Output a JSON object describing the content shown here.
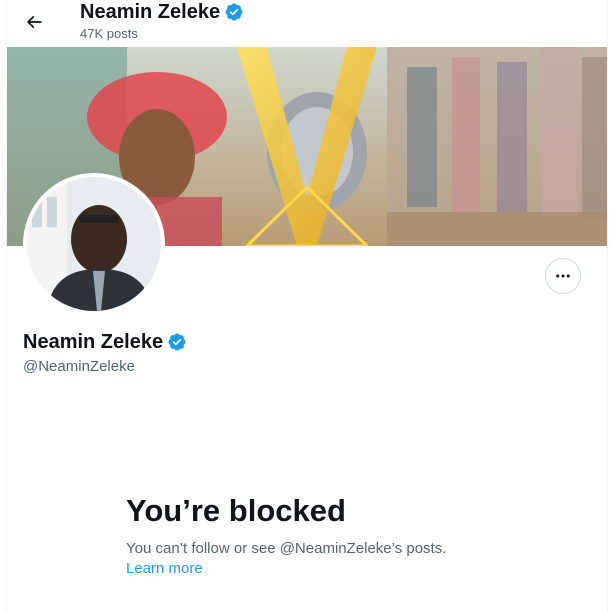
{
  "header": {
    "back_icon": "arrow-left-icon",
    "title": "Neamin Zeleke",
    "posts_count": "47K posts",
    "verified_icon": "verified-badge-icon"
  },
  "profile": {
    "name": "Neamin Zeleke",
    "handle": "@NeaminZeleke",
    "more_icon": "more-horizontal-icon"
  },
  "blocked": {
    "title": "You’re blocked",
    "description": "You can’t follow or see @NeaminZeleke’s posts.",
    "learn_more": "Learn more"
  },
  "colors": {
    "accent": "#1d9bf0",
    "text_primary": "#0f1419",
    "text_secondary": "#536471",
    "border": "#cfd9de"
  }
}
